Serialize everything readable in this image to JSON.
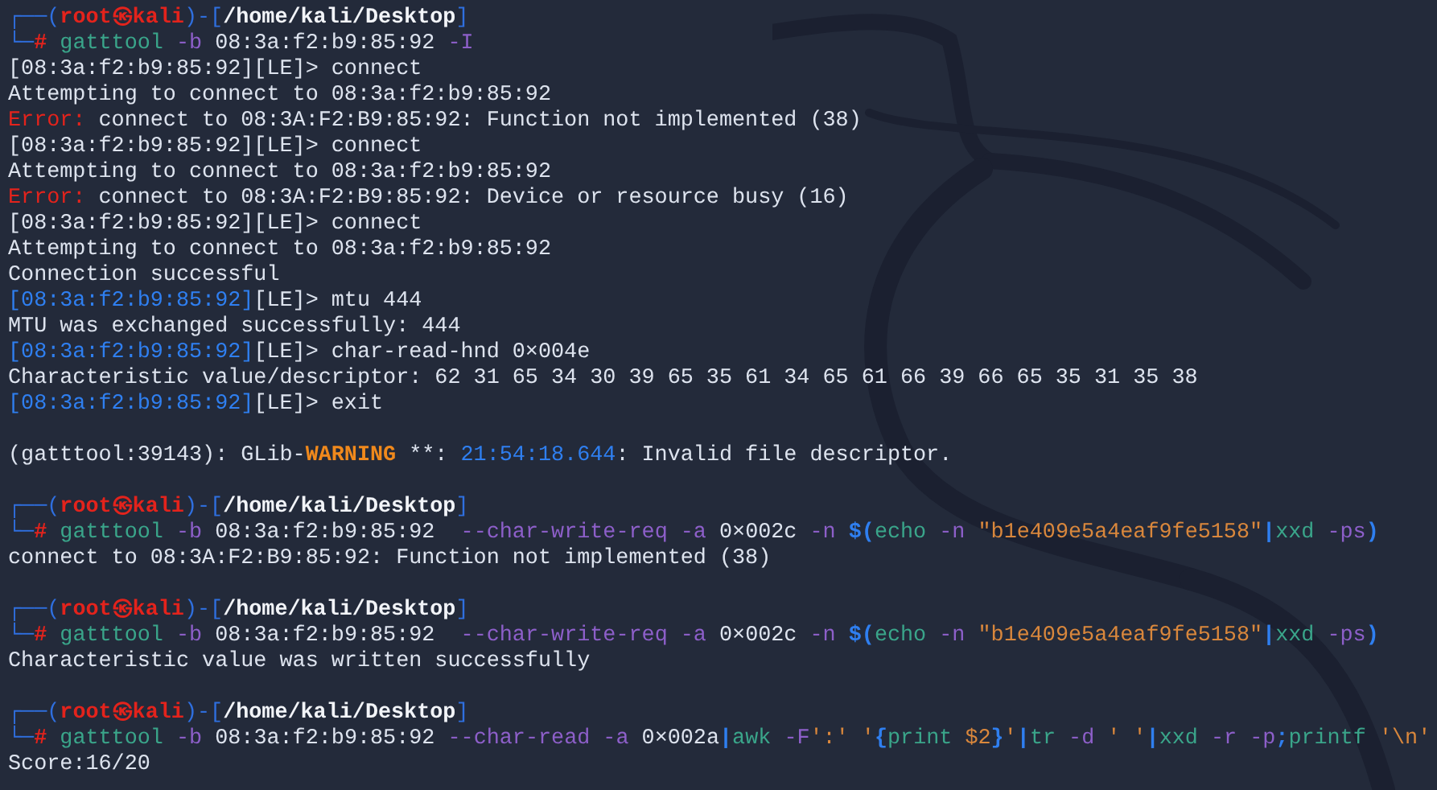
{
  "terminal": {
    "blocks": [
      {
        "lines": [
          [
            {
              "kind": "frame",
              "text": "┌──("
            },
            {
              "kind": "user",
              "text": "root㉿kali"
            },
            {
              "kind": "frame",
              "text": ")-["
            },
            {
              "kind": "path",
              "text": "/home/kali/Desktop"
            },
            {
              "kind": "frame",
              "text": "]"
            }
          ],
          [
            {
              "kind": "frame",
              "text": "└─"
            },
            {
              "kind": "hash",
              "text": "#"
            },
            {
              "kind": "command",
              "text": " gatttool"
            },
            {
              "kind": "option",
              "text": " -b"
            },
            {
              "kind": "plain",
              "text": " 08:3a:f2:b9:85:92"
            },
            {
              "kind": "option",
              "text": " -I"
            }
          ],
          [
            {
              "kind": "plain",
              "text": "[08:3a:f2:b9:85:92][LE]> connect"
            }
          ],
          [
            {
              "kind": "plain",
              "text": "Attempting to connect to 08:3a:f2:b9:85:92"
            }
          ],
          [
            {
              "kind": "error",
              "text": "Error:"
            },
            {
              "kind": "plain",
              "text": " connect to 08:3A:F2:B9:85:92: Function not implemented (38)"
            }
          ],
          [
            {
              "kind": "plain",
              "text": "[08:3a:f2:b9:85:92][LE]> connect"
            }
          ],
          [
            {
              "kind": "plain",
              "text": "Attempting to connect to 08:3a:f2:b9:85:92"
            }
          ],
          [
            {
              "kind": "error",
              "text": "Error:"
            },
            {
              "kind": "plain",
              "text": " connect to 08:3A:F2:B9:85:92: Device or resource busy (16)"
            }
          ],
          [
            {
              "kind": "plain",
              "text": "[08:3a:f2:b9:85:92][LE]> connect"
            }
          ],
          [
            {
              "kind": "plain",
              "text": "Attempting to connect to 08:3a:f2:b9:85:92"
            }
          ],
          [
            {
              "kind": "plain",
              "text": "Connection successful"
            }
          ],
          [
            {
              "kind": "addr",
              "text": "[08:3a:f2:b9:85:92]"
            },
            {
              "kind": "plain",
              "text": "[LE]> mtu 444"
            }
          ],
          [
            {
              "kind": "plain",
              "text": "MTU was exchanged successfully: 444"
            }
          ],
          [
            {
              "kind": "addr",
              "text": "[08:3a:f2:b9:85:92]"
            },
            {
              "kind": "plain",
              "text": "[LE]> char-read-hnd 0×004e"
            }
          ],
          [
            {
              "kind": "plain",
              "text": "Characteristic value/descriptor: 62 31 65 34 30 39 65 35 61 34 65 61 66 39 66 65 35 31 35 38"
            }
          ],
          [
            {
              "kind": "addr",
              "text": "[08:3a:f2:b9:85:92]"
            },
            {
              "kind": "plain",
              "text": "[LE]> exit"
            }
          ]
        ]
      },
      {
        "lines": [
          [
            {
              "kind": "plain",
              "text": "(gatttool:39143): GLib-"
            },
            {
              "kind": "warning",
              "text": "WARNING"
            },
            {
              "kind": "plain",
              "text": " **: "
            },
            {
              "kind": "time",
              "text": "21:54:18.644"
            },
            {
              "kind": "plain",
              "text": ": Invalid file descriptor."
            }
          ]
        ]
      },
      {
        "lines": [
          [
            {
              "kind": "frame",
              "text": "┌──("
            },
            {
              "kind": "user",
              "text": "root㉿kali"
            },
            {
              "kind": "frame",
              "text": ")-["
            },
            {
              "kind": "path",
              "text": "/home/kali/Desktop"
            },
            {
              "kind": "frame",
              "text": "]"
            }
          ],
          [
            {
              "kind": "frame",
              "text": "└─"
            },
            {
              "kind": "hash",
              "text": "#"
            },
            {
              "kind": "command",
              "text": " gatttool"
            },
            {
              "kind": "option",
              "text": " -b"
            },
            {
              "kind": "plain",
              "text": " 08:3a:f2:b9:85:92  "
            },
            {
              "kind": "option",
              "text": "--char-write-req -a"
            },
            {
              "kind": "plain",
              "text": " 0×002c "
            },
            {
              "kind": "option",
              "text": "-n"
            },
            {
              "kind": "operator",
              "text": " $("
            },
            {
              "kind": "command",
              "text": "echo"
            },
            {
              "kind": "option",
              "text": " -n"
            },
            {
              "kind": "string",
              "text": " \"b1e409e5a4eaf9fe5158\""
            },
            {
              "kind": "operator",
              "text": "|"
            },
            {
              "kind": "command",
              "text": "xxd"
            },
            {
              "kind": "option",
              "text": " -ps"
            },
            {
              "kind": "operator",
              "text": ")"
            }
          ],
          [
            {
              "kind": "plain",
              "text": "connect to 08:3A:F2:B9:85:92: Function not implemented (38)"
            }
          ]
        ]
      },
      {
        "lines": [
          [
            {
              "kind": "frame",
              "text": "┌──("
            },
            {
              "kind": "user",
              "text": "root㉿kali"
            },
            {
              "kind": "frame",
              "text": ")-["
            },
            {
              "kind": "path",
              "text": "/home/kali/Desktop"
            },
            {
              "kind": "frame",
              "text": "]"
            }
          ],
          [
            {
              "kind": "frame",
              "text": "└─"
            },
            {
              "kind": "hash",
              "text": "#"
            },
            {
              "kind": "command",
              "text": " gatttool"
            },
            {
              "kind": "option",
              "text": " -b"
            },
            {
              "kind": "plain",
              "text": " 08:3a:f2:b9:85:92  "
            },
            {
              "kind": "option",
              "text": "--char-write-req -a"
            },
            {
              "kind": "plain",
              "text": " 0×002c "
            },
            {
              "kind": "option",
              "text": "-n"
            },
            {
              "kind": "operator",
              "text": " $("
            },
            {
              "kind": "command",
              "text": "echo"
            },
            {
              "kind": "option",
              "text": " -n"
            },
            {
              "kind": "string",
              "text": " \"b1e409e5a4eaf9fe5158\""
            },
            {
              "kind": "operator",
              "text": "|"
            },
            {
              "kind": "command",
              "text": "xxd"
            },
            {
              "kind": "option",
              "text": " -ps"
            },
            {
              "kind": "operator",
              "text": ")"
            }
          ],
          [
            {
              "kind": "plain",
              "text": "Characteristic value was written successfully"
            }
          ]
        ]
      },
      {
        "lines": [
          [
            {
              "kind": "frame",
              "text": "┌──("
            },
            {
              "kind": "user",
              "text": "root㉿kali"
            },
            {
              "kind": "frame",
              "text": ")-["
            },
            {
              "kind": "path",
              "text": "/home/kali/Desktop"
            },
            {
              "kind": "frame",
              "text": "]"
            }
          ],
          [
            {
              "kind": "frame",
              "text": "└─"
            },
            {
              "kind": "hash",
              "text": "#"
            },
            {
              "kind": "command",
              "text": " gatttool"
            },
            {
              "kind": "option",
              "text": " -b"
            },
            {
              "kind": "plain",
              "text": " 08:3a:f2:b9:85:92 "
            },
            {
              "kind": "option",
              "text": "--char-read -a"
            },
            {
              "kind": "plain",
              "text": " 0×002a"
            },
            {
              "kind": "operator",
              "text": "|"
            },
            {
              "kind": "command",
              "text": "awk"
            },
            {
              "kind": "option",
              "text": " -F"
            },
            {
              "kind": "string",
              "text": "':'"
            },
            {
              "kind": "string",
              "text": " '"
            },
            {
              "kind": "operator",
              "text": "{"
            },
            {
              "kind": "command",
              "text": "print"
            },
            {
              "kind": "string",
              "text": " $2"
            },
            {
              "kind": "operator",
              "text": "}"
            },
            {
              "kind": "string",
              "text": "'"
            },
            {
              "kind": "operator",
              "text": "|"
            },
            {
              "kind": "command",
              "text": "tr"
            },
            {
              "kind": "option",
              "text": " -d"
            },
            {
              "kind": "string",
              "text": " ' '"
            },
            {
              "kind": "operator",
              "text": "|"
            },
            {
              "kind": "command",
              "text": "xxd"
            },
            {
              "kind": "option",
              "text": " -r -p"
            },
            {
              "kind": "operator",
              "text": ";"
            },
            {
              "kind": "command",
              "text": "printf"
            },
            {
              "kind": "string",
              "text": " '\\n'"
            }
          ],
          [
            {
              "kind": "plain",
              "text": "Score:16/20"
            }
          ]
        ]
      }
    ]
  }
}
